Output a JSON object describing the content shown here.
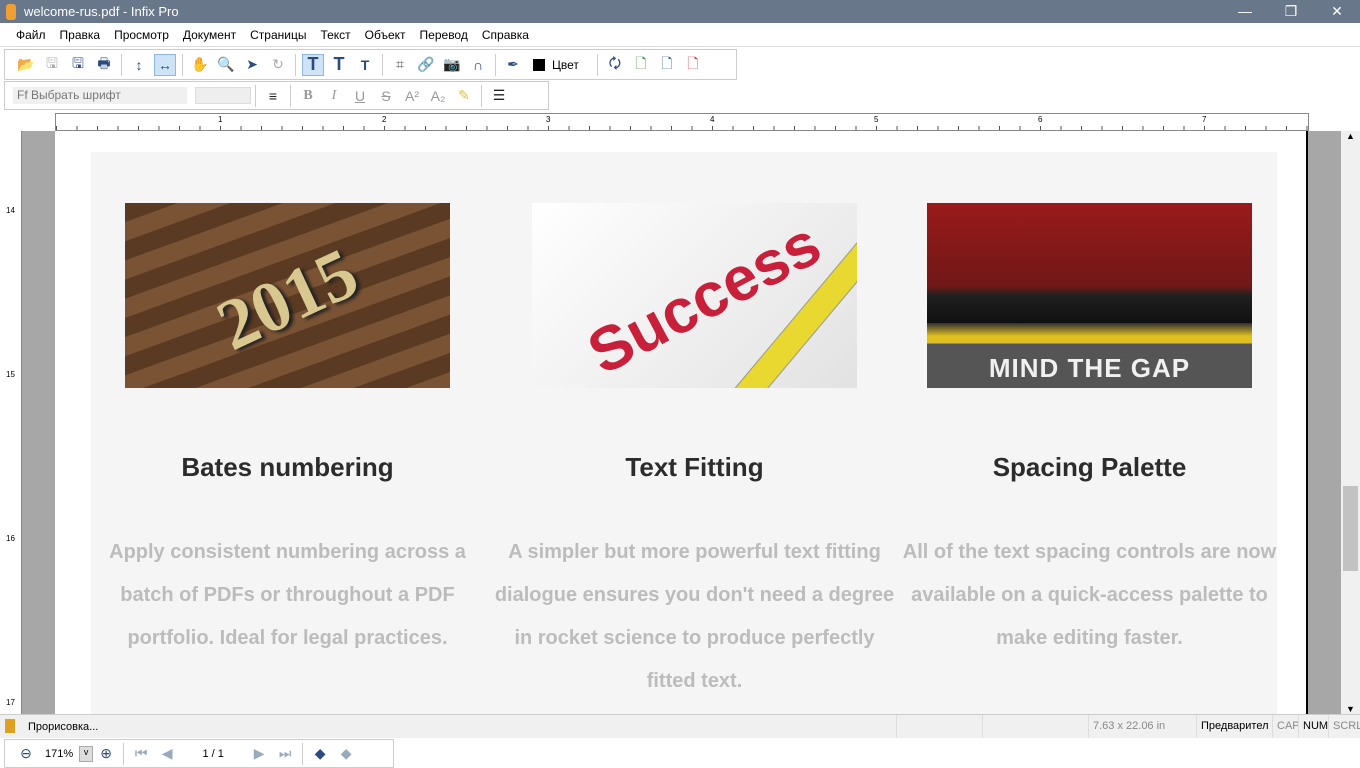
{
  "window": {
    "title": "welcome-rus.pdf - Infix Pro",
    "minimize": "—",
    "maximize": "❐",
    "close": "✕"
  },
  "menu": [
    "Файл",
    "Правка",
    "Просмотр",
    "Документ",
    "Страницы",
    "Текст",
    "Объект",
    "Перевод",
    "Справка"
  ],
  "toolbar": {
    "color_label": "Цвет",
    "font_placeholder": "Выбрать шрифт"
  },
  "ruler": {
    "h_ticks": [
      "1",
      "2",
      "3",
      "4",
      "5",
      "6",
      "7"
    ],
    "v_ticks": [
      "14",
      "15",
      "16",
      "17"
    ]
  },
  "columns": [
    {
      "image_text": "2015",
      "heading": "Bates numbering",
      "body": "Apply consistent numbering across a batch of PDFs or throughout a PDF portfolio. Ideal for legal practices."
    },
    {
      "image_text": "Success",
      "heading": "Text Fitting",
      "body": "A simpler but more powerful text fitting dialogue ensures you don't need a degree in rocket science to produce perfectly fitted text."
    },
    {
      "image_text": "MIND THE GAP",
      "heading": "Spacing Palette",
      "body": "All of the text spacing controls are now available on a quick-access palette to make editing faster."
    }
  ],
  "status": {
    "message": "Прорисовка...",
    "page_size": "7.63 x 22.06 in",
    "mode": "Предварител",
    "cap": "CAP",
    "num": "NUM",
    "scrl": "SCRL"
  },
  "nav": {
    "zoom": "171%",
    "page": "1 / 1"
  }
}
